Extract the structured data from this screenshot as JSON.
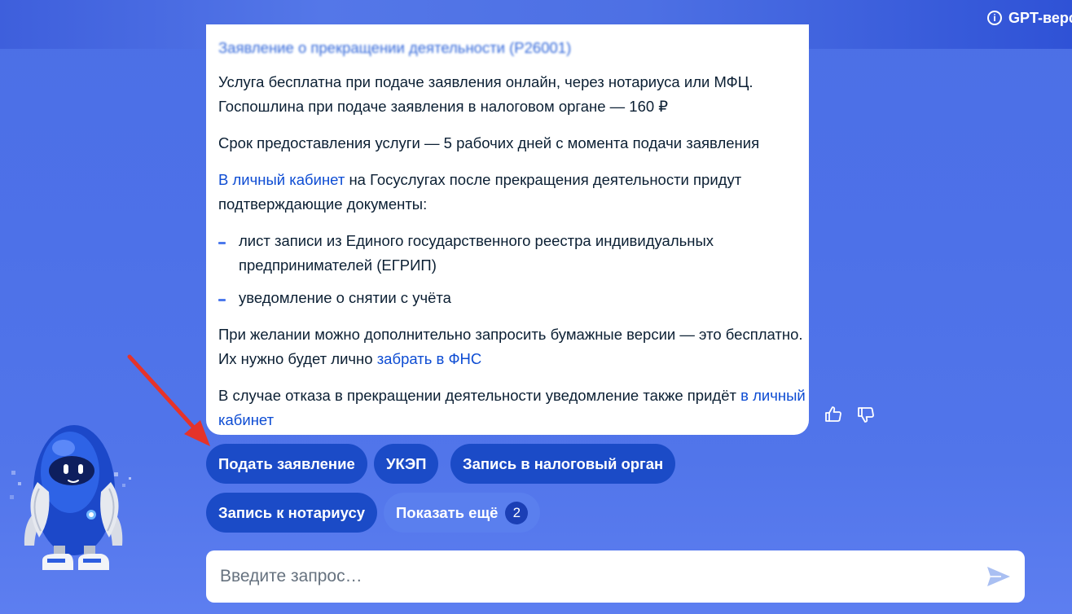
{
  "header": {
    "gpt_version_label": "GPT-версия"
  },
  "icons": {
    "info": "info-icon",
    "like": "thumbs-up-icon",
    "dislike": "thumbs-down-icon",
    "send": "send-icon",
    "assistant": "robot-assistant-icon"
  },
  "colors": {
    "background": "#4c6fe6",
    "link": "#0d4cd3",
    "chip_primary": "#1b4bc7",
    "chip_secondary": "#5a7fee",
    "annotation_arrow": "#e5332a"
  },
  "message": {
    "cut_off_line": "Заявление о прекращении деятельности (Р26001)",
    "fee_text": "Услуга бесплатна при подаче заявления онлайн, через нотариуса или МФЦ. Госпошлина при подаче заявления в налоговом органе — 160 ₽",
    "term_text": "Срок предоставления услуги — 5 рабочих дней с момента подачи заявления",
    "cabinet_link": "В личный кабинет",
    "cabinet_text": " на Госуслугах после прекращения деятельности придут подтверждающие документы:",
    "documents": [
      "лист записи из Единого государственного реестра индивидуальных предпринимателей (ЕГРИП)",
      "уведомление о снятии с учёта"
    ],
    "paper_text": "При желании можно дополнительно запросить бумажные версии — это бесплатно. Их нужно будет лично ",
    "paper_link": "забрать в ФНС",
    "refusal_text": "В случае отказа в прекращении деятельности уведомление также придёт ",
    "refusal_link": "в личный кабинет"
  },
  "chips": {
    "submit": "Подать заявление",
    "ukep": "УКЭП",
    "tax_office": "Запись в налоговый орган",
    "notary": "Запись к нотариусу",
    "show_more": "Показать ещё",
    "show_more_count": "2"
  },
  "input": {
    "placeholder": "Введите запрос…",
    "value": ""
  }
}
